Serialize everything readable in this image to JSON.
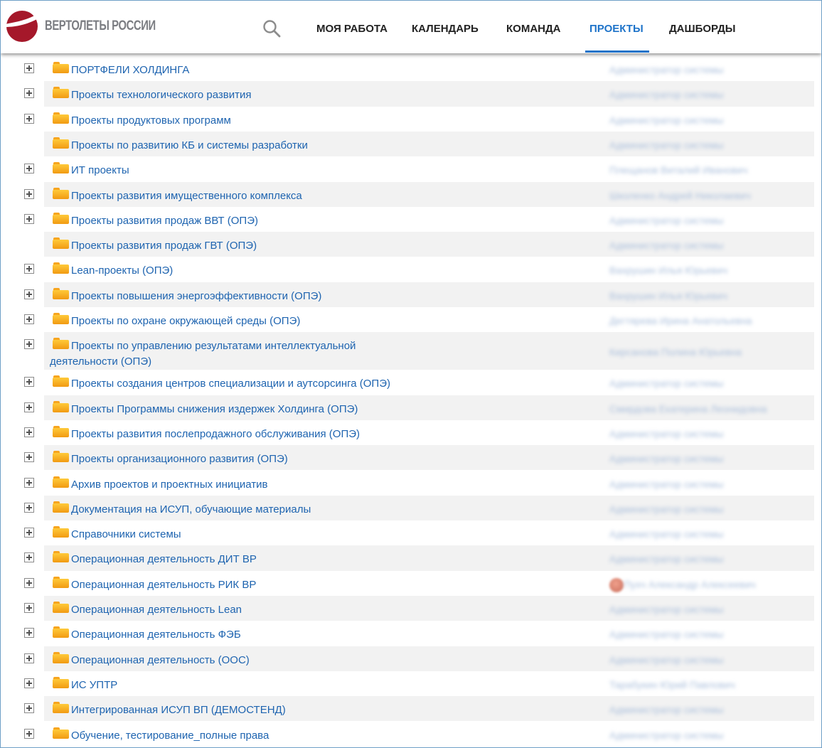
{
  "header": {
    "logo_text": "ВЕРТОЛЕТЫ РОССИИ",
    "search_icon": "search-icon",
    "nav": [
      {
        "label": "МОЯ РАБОТА",
        "active": false
      },
      {
        "label": "КАЛЕНДАРЬ",
        "active": false
      },
      {
        "label": "КОМАНДА",
        "active": false
      },
      {
        "label": "ПРОЕКТЫ",
        "active": true
      },
      {
        "label": "ДАШБОРДЫ",
        "active": false
      }
    ]
  },
  "colors": {
    "accent": "#1e73c9",
    "link": "#1e64b0",
    "row_alt": "#f2f2f2",
    "folder": "#f7a51e",
    "logo_red": "#a5182a"
  },
  "tree": {
    "rows": [
      {
        "label": "ПОРТФЕЛИ ХОЛДИНГА",
        "owner": "Администратор системы",
        "expandable": true
      },
      {
        "label": "Проекты технологического развития",
        "owner": "Администратор системы",
        "expandable": true
      },
      {
        "label": "Проекты продуктовых программ",
        "owner": "Администратор системы",
        "expandable": true
      },
      {
        "label": "Проекты по развитию КБ и системы разработки",
        "owner": "Администратор системы",
        "expandable": false
      },
      {
        "label": "ИТ проекты",
        "owner": "Плещанов Виталий Иванович",
        "expandable": true
      },
      {
        "label": "Проекты развития имущественного комплекса",
        "owner": "Школенко Андрей Николаевич",
        "expandable": true
      },
      {
        "label": "Проекты развития продаж ВВТ (ОПЭ)",
        "owner": "Администратор системы",
        "expandable": true
      },
      {
        "label": "Проекты развития продаж ГВТ (ОПЭ)",
        "owner": "Администратор системы",
        "expandable": false
      },
      {
        "label": "Lean-проекты (ОПЭ)",
        "owner": "Вахрушин Илья Юрьевич",
        "expandable": true
      },
      {
        "label": "Проекты повышения энергоэффективности (ОПЭ)",
        "owner": "Вахрушин Илья Юрьевич",
        "expandable": true
      },
      {
        "label": "Проекты по охране окружающей среды (ОПЭ)",
        "owner": "Дегтярева Ирина Анатольевна",
        "expandable": true
      },
      {
        "label": "Проекты по управлению результатами интеллектуальной деятельности (ОПЭ)",
        "owner": "Кирсанова Полина Юрьевна",
        "expandable": true
      },
      {
        "label": "Проекты создания центров специализации и аутсорсинга (ОПЭ)",
        "owner": "Администратор системы",
        "expandable": true
      },
      {
        "label": "Проекты Программы снижения издержек Холдинга (ОПЭ)",
        "owner": "Смирдова Екатерина Леонидовна",
        "expandable": true
      },
      {
        "label": "Проекты развития послепродажного обслуживания (ОПЭ)",
        "owner": "Администратор системы",
        "expandable": true
      },
      {
        "label": "Проекты организационного развития (ОПЭ)",
        "owner": "Администратор системы",
        "expandable": true
      },
      {
        "label": "Архив проектов и проектных инициатив",
        "owner": "Администратор системы",
        "expandable": true
      },
      {
        "label": "Документация на ИСУП, обучающие материалы",
        "owner": "Администратор системы",
        "expandable": true
      },
      {
        "label": "Справочники системы",
        "owner": "Администратор системы",
        "expandable": true
      },
      {
        "label": "Операционная деятельность ДИТ ВР",
        "owner": "Администратор системы",
        "expandable": true
      },
      {
        "label": "Операционная деятельность РИК ВР",
        "owner": "Пухч Александр Алексеевич",
        "expandable": true,
        "avatar": true
      },
      {
        "label": "Операционная деятельность Lean",
        "owner": "Администратор системы",
        "expandable": true
      },
      {
        "label": "Операционная деятельность ФЭБ",
        "owner": "Администратор системы",
        "expandable": true
      },
      {
        "label": "Операционная деятельность (ООС)",
        "owner": "Администратор системы",
        "expandable": true
      },
      {
        "label": "ИС УПТР",
        "owner": "Тарабукин Юрий Павлович",
        "expandable": true
      },
      {
        "label": "Интегрированная ИСУП ВП (ДЕМОСТЕНД)",
        "owner": "Администратор системы",
        "expandable": true
      },
      {
        "label": "Обучение, тестирование_полные права",
        "owner": "Администратор системы",
        "expandable": true
      }
    ]
  }
}
